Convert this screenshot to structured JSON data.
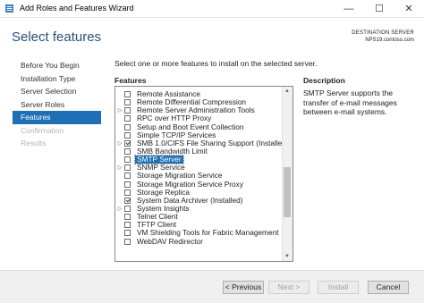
{
  "window": {
    "title": "Add Roles and Features Wizard",
    "min_glyph": "—",
    "max_glyph": "☐",
    "close_glyph": "✕"
  },
  "header": {
    "title": "Select features",
    "destination_label": "DESTINATION SERVER",
    "destination_server": "NPS19.contoso.com"
  },
  "nav": [
    {
      "label": "Before You Begin",
      "state": "normal"
    },
    {
      "label": "Installation Type",
      "state": "normal"
    },
    {
      "label": "Server Selection",
      "state": "normal"
    },
    {
      "label": "Server Roles",
      "state": "normal"
    },
    {
      "label": "Features",
      "state": "active"
    },
    {
      "label": "Confirmation",
      "state": "disabled"
    },
    {
      "label": "Results",
      "state": "disabled"
    }
  ],
  "main": {
    "instructions": "Select one or more features to install on the selected server.",
    "features_heading": "Features",
    "description_heading": "Description",
    "description_text": "SMTP Server supports the transfer of e-mail messages between e-mail systems."
  },
  "features": [
    {
      "label": "Remote Assistance",
      "checked": false,
      "expandable": false,
      "selected": false
    },
    {
      "label": "Remote Differential Compression",
      "checked": false,
      "expandable": false,
      "selected": false
    },
    {
      "label": "Remote Server Administration Tools",
      "checked": false,
      "expandable": true,
      "selected": false
    },
    {
      "label": "RPC over HTTP Proxy",
      "checked": false,
      "expandable": false,
      "selected": false
    },
    {
      "label": "Setup and Boot Event Collection",
      "checked": false,
      "expandable": false,
      "selected": false
    },
    {
      "label": "Simple TCP/IP Services",
      "checked": false,
      "expandable": false,
      "selected": false
    },
    {
      "label": "SMB 1.0/CIFS File Sharing Support (Installed)",
      "checked": true,
      "expandable": true,
      "selected": false
    },
    {
      "label": "SMB Bandwidth Limit",
      "checked": false,
      "expandable": false,
      "selected": false
    },
    {
      "label": "SMTP Server",
      "checked": false,
      "expandable": false,
      "selected": true
    },
    {
      "label": "SNMP Service",
      "checked": false,
      "expandable": true,
      "selected": false
    },
    {
      "label": "Storage Migration Service",
      "checked": false,
      "expandable": false,
      "selected": false
    },
    {
      "label": "Storage Migration Service Proxy",
      "checked": false,
      "expandable": false,
      "selected": false
    },
    {
      "label": "Storage Replica",
      "checked": false,
      "expandable": false,
      "selected": false
    },
    {
      "label": "System Data Archiver (Installed)",
      "checked": true,
      "expandable": false,
      "selected": false
    },
    {
      "label": "System Insights",
      "checked": false,
      "expandable": true,
      "selected": false
    },
    {
      "label": "Telnet Client",
      "checked": false,
      "expandable": false,
      "selected": false
    },
    {
      "label": "TFTP Client",
      "checked": false,
      "expandable": false,
      "selected": false
    },
    {
      "label": "VM Shielding Tools for Fabric Management",
      "checked": false,
      "expandable": false,
      "selected": false
    },
    {
      "label": "WebDAV Redirector",
      "checked": false,
      "expandable": false,
      "selected": false
    }
  ],
  "buttons": {
    "previous": "< Previous",
    "next": "Next >",
    "install": "Install",
    "cancel": "Cancel"
  },
  "colors": {
    "accent": "#1e6fb5",
    "title_text": "#2b4f7a"
  }
}
